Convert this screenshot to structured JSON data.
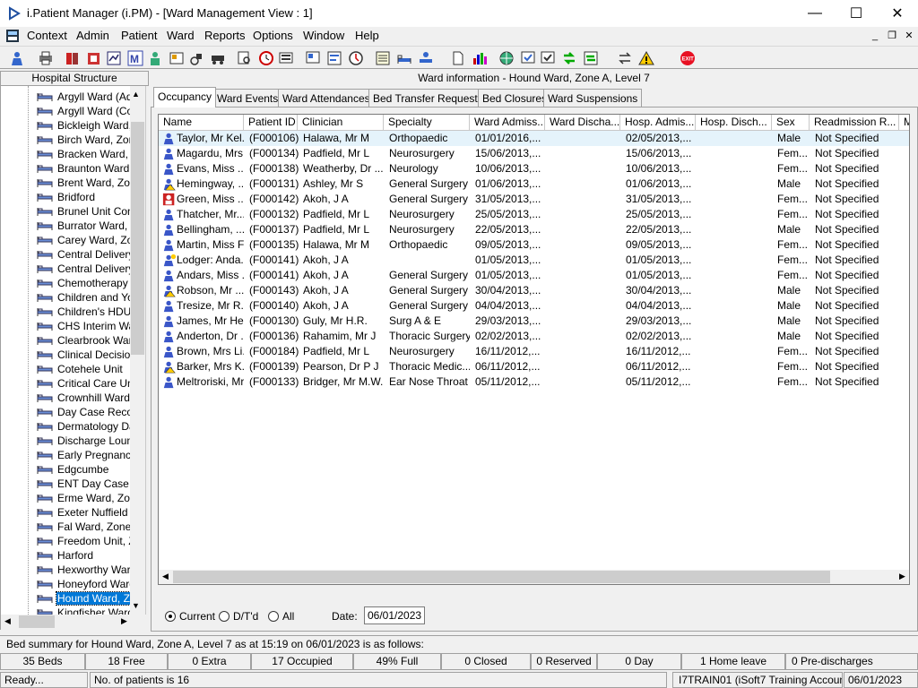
{
  "window": {
    "title": "i.Patient Manager (i.PM) - [Ward Management View : 1]",
    "controls": {
      "minimize": "—",
      "maximize": "☐",
      "close": "✕"
    }
  },
  "menu": {
    "items": [
      "Context",
      "Admin",
      "Patient",
      "Ward",
      "Reports",
      "Options",
      "Window",
      "Help"
    ],
    "mdi": {
      "minimize": "_",
      "restore": "❐",
      "close": "✕"
    }
  },
  "toolbar": {
    "icons": [
      "person-icon",
      "printer-icon",
      "books-icon",
      "notes-icon",
      "chart-icon",
      "m-icon",
      "nurse-icon",
      "card-icon",
      "wheelchair-icon",
      "transport-icon",
      "search-doc-icon",
      "clock-icon",
      "monitor-icon",
      "screen-icon",
      "report-icon",
      "clock-check-icon",
      "list-icon",
      "bed-icon",
      "bed-person-icon",
      "document-icon",
      "bar-chart-icon",
      "globe-icon",
      "check-doc-icon",
      "verify-icon",
      "transfer-icon",
      "green-arrows-icon",
      "swap-icon",
      "warning-icon",
      "exit-icon"
    ],
    "exit_label": "EXIT"
  },
  "left": {
    "header": "Hospital Structure",
    "tree": [
      "Argyll Ward (Adul",
      "Argyll Ward (Cots",
      "Bickleigh Ward, Z",
      "Birch Ward, Zone",
      "Bracken Ward, Z",
      "Braunton Ward, Z",
      "Brent Ward, Zone",
      "Bridford",
      "Brunel Unit Conti",
      "Burrator Ward, Zo",
      "Carey Ward, Zon",
      "Central Delivery S",
      "Central Delivery S",
      "Chemotherapy D",
      "Children and You",
      "Children's HDU (V",
      "CHS Interim Ward",
      "Clearbrook Ward",
      "Clinical Decision",
      "Cotehele Unit",
      "Critical Care Unit",
      "Crownhill Ward, Z",
      "Day Case Recov",
      "Dermatology Day",
      "Discharge Loung",
      "Early Pregnancy",
      "Edgcumbe",
      "ENT Day Case U",
      "Erme Ward, Zone",
      "Exeter Nuffield H",
      "Fal Ward, Zone E",
      "Freedom Unit, Zo",
      "Harford",
      "Hexworthy Ward,",
      "Honeyford Ward,",
      "Hound Ward, Zo",
      "Kingfisher Ward"
    ],
    "selected_index": 35
  },
  "right": {
    "header": "Ward information - Hound Ward, Zone A, Level 7",
    "tabs": [
      "Occupancy",
      "Ward Events",
      "Ward Attendances",
      "Bed Transfer Requests",
      "Bed Closures",
      "Ward Suspensions"
    ],
    "active_tab": 0,
    "columns": [
      "Name",
      "Patient ID",
      "Clinician",
      "Specialty",
      "Ward Admiss...",
      "Ward Discha...",
      "Hosp. Admis...",
      "Hosp. Disch...",
      "Sex",
      "Readmission R...",
      "M"
    ],
    "rows": [
      {
        "icon": "patient-icon",
        "name": "Taylor, Mr Kel...",
        "id": "(F000106)",
        "clinician": "Halawa, Mr M",
        "specialty": "Orthopaedic",
        "ward_adm": "01/01/2016,...",
        "hosp_adm": "02/05/2013,...",
        "sex": "Male",
        "readm": "Not Specified"
      },
      {
        "icon": "patient-icon",
        "name": "Magardu, Mrs...",
        "id": "(F000134)",
        "clinician": "Padfield, Mr L",
        "specialty": "Neurosurgery",
        "ward_adm": "15/06/2013,...",
        "hosp_adm": "15/06/2013,...",
        "sex": "Fem...",
        "readm": "Not Specified"
      },
      {
        "icon": "patient-icon",
        "name": "Evans, Miss ...",
        "id": "(F000138)",
        "clinician": "Weatherby, Dr ...",
        "specialty": "Neurology",
        "ward_adm": "10/06/2013,...",
        "hosp_adm": "10/06/2013,...",
        "sex": "Fem...",
        "readm": "Not Specified"
      },
      {
        "icon": "patient-alert-icon",
        "name": "Hemingway, ...",
        "id": "(F000131)",
        "clinician": "Ashley, Mr S",
        "specialty": "General Surgery",
        "ward_adm": "01/06/2013,...",
        "hosp_adm": "01/06/2013,...",
        "sex": "Male",
        "readm": "Not Specified"
      },
      {
        "icon": "patient-red-icon",
        "name": "Green, Miss ...",
        "id": "(F000142)",
        "clinician": "Akoh, J A",
        "specialty": "General Surgery",
        "ward_adm": "31/05/2013,...",
        "hosp_adm": "31/05/2013,...",
        "sex": "Fem...",
        "readm": "Not Specified"
      },
      {
        "icon": "patient-icon",
        "name": "Thatcher, Mr...",
        "id": "(F000132)",
        "clinician": "Padfield, Mr L",
        "specialty": "Neurosurgery",
        "ward_adm": "25/05/2013,...",
        "hosp_adm": "25/05/2013,...",
        "sex": "Fem...",
        "readm": "Not Specified"
      },
      {
        "icon": "patient-icon",
        "name": "Bellingham, ...",
        "id": "(F000137)",
        "clinician": "Padfield, Mr L",
        "specialty": "Neurosurgery",
        "ward_adm": "22/05/2013,...",
        "hosp_adm": "22/05/2013,...",
        "sex": "Male",
        "readm": "Not Specified"
      },
      {
        "icon": "patient-icon",
        "name": "Martin, Miss F...",
        "id": "(F000135)",
        "clinician": "Halawa, Mr M",
        "specialty": "Orthopaedic",
        "ward_adm": "09/05/2013,...",
        "hosp_adm": "09/05/2013,...",
        "sex": "Fem...",
        "readm": "Not Specified"
      },
      {
        "icon": "patient-yellow-icon",
        "name": "Lodger: Anda...",
        "id": "(F000141)",
        "clinician": "Akoh, J A",
        "specialty": "",
        "ward_adm": "01/05/2013,...",
        "hosp_adm": "01/05/2013,...",
        "sex": "Fem...",
        "readm": "Not Specified"
      },
      {
        "icon": "patient-icon",
        "name": "Andars, Miss ...",
        "id": "(F000141)",
        "clinician": "Akoh, J A",
        "specialty": "General Surgery",
        "ward_adm": "01/05/2013,...",
        "hosp_adm": "01/05/2013,...",
        "sex": "Fem...",
        "readm": "Not Specified"
      },
      {
        "icon": "patient-alert-icon",
        "name": "Robson, Mr ...",
        "id": "(F000143)",
        "clinician": "Akoh, J A",
        "specialty": "General Surgery",
        "ward_adm": "30/04/2013,...",
        "hosp_adm": "30/04/2013,...",
        "sex": "Male",
        "readm": "Not Specified"
      },
      {
        "icon": "patient-icon",
        "name": "Tresize, Mr R...",
        "id": "(F000140)",
        "clinician": "Akoh, J A",
        "specialty": "General Surgery",
        "ward_adm": "04/04/2013,...",
        "hosp_adm": "04/04/2013,...",
        "sex": "Male",
        "readm": "Not Specified"
      },
      {
        "icon": "patient-icon",
        "name": "James, Mr He...",
        "id": "(F000130)",
        "clinician": "Guly, Mr H.R.",
        "specialty": "Surg A & E",
        "ward_adm": "29/03/2013,...",
        "hosp_adm": "29/03/2013,...",
        "sex": "Male",
        "readm": "Not Specified"
      },
      {
        "icon": "patient-icon",
        "name": "Anderton, Dr ...",
        "id": "(F000136)",
        "clinician": "Rahamim, Mr J",
        "specialty": "Thoracic Surgery",
        "ward_adm": "02/02/2013,...",
        "hosp_adm": "02/02/2013,...",
        "sex": "Male",
        "readm": "Not Specified"
      },
      {
        "icon": "patient-icon",
        "name": "Brown, Mrs Li...",
        "id": "(F000184)",
        "clinician": "Padfield, Mr L",
        "specialty": "Neurosurgery",
        "ward_adm": "16/11/2012,...",
        "hosp_adm": "16/11/2012,...",
        "sex": "Fem...",
        "readm": "Not Specified"
      },
      {
        "icon": "patient-alert-icon",
        "name": "Barker, Mrs K...",
        "id": "(F000139)",
        "clinician": "Pearson, Dr P J",
        "specialty": "Thoracic Medic...",
        "ward_adm": "06/11/2012,...",
        "hosp_adm": "06/11/2012,...",
        "sex": "Fem...",
        "readm": "Not Specified"
      },
      {
        "icon": "patient-icon",
        "name": "Meltroriski, Mr...",
        "id": "(F000133)",
        "clinician": "Bridger, Mr M.W.",
        "specialty": "Ear Nose Throat",
        "ward_adm": "05/11/2012,...",
        "hosp_adm": "05/11/2012,...",
        "sex": "Fem...",
        "readm": "Not Specified"
      }
    ],
    "filter": {
      "options": [
        "Current",
        "D/T'd",
        "All"
      ],
      "selected": 0,
      "date_label": "Date:",
      "date_value": "06/01/2023"
    }
  },
  "summary": "Bed summary for Hound Ward, Zone A, Level 7 as at 15:19 on 06/01/2023 is as follows:",
  "stats": [
    "35 Beds",
    "18 Free",
    "0 Extra",
    "17 Occupied",
    "49% Full",
    "0 Closed",
    "0 Reserved",
    "0 Day",
    "1 Home leave",
    "0 Pre-discharges"
  ],
  "status": {
    "ready": "Ready...",
    "patients": "No. of patients is 16",
    "user": "I7TRAIN01 (iSoft7 Training Account)",
    "date": "06/01/2023"
  },
  "colors": {
    "selection": "#0078d7",
    "row_highlight": "#e5f3fb",
    "exit_red": "#e81123"
  }
}
